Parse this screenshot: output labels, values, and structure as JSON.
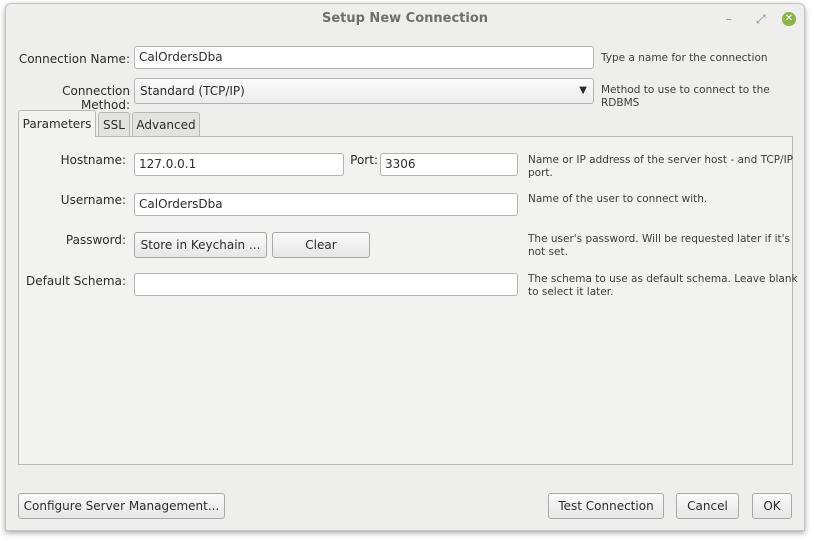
{
  "window": {
    "title": "Setup New Connection",
    "controls": {
      "minimize": "–",
      "maximize": "⤢",
      "close": "✕"
    }
  },
  "connection_name": {
    "label": "Connection Name:",
    "value": "CalOrdersDba",
    "hint": "Type a name for the connection"
  },
  "connection_method": {
    "label": "Connection Method:",
    "value": "Standard (TCP/IP)",
    "hint": "Method to use to connect to the RDBMS"
  },
  "tabs": [
    {
      "label": "Parameters",
      "active": true
    },
    {
      "label": "SSL",
      "active": false
    },
    {
      "label": "Advanced",
      "active": false
    }
  ],
  "parameters": {
    "hostname": {
      "label": "Hostname:",
      "value": "127.0.0.1",
      "port_label": "Port:",
      "port_value": "3306",
      "hint_line1": "Name or IP address of the server host - and TCP/IP",
      "hint_line2": "port."
    },
    "username": {
      "label": "Username:",
      "value": "CalOrdersDba",
      "hint": "Name of the user to connect with."
    },
    "password": {
      "label": "Password:",
      "store_button": "Store in Keychain ...",
      "clear_button": "Clear",
      "hint_line1": "The user's password. Will be requested later if it's",
      "hint_line2": "not set."
    },
    "default_schema": {
      "label": "Default Schema:",
      "value": "",
      "hint_line1": "The schema to use as default schema. Leave blank",
      "hint_line2": "to select it later."
    }
  },
  "footer": {
    "configure_button": "Configure Server Management...",
    "test_button": "Test Connection",
    "cancel_button": "Cancel",
    "ok_button": "OK"
  },
  "colors": {
    "window_bg": "#eeeeec",
    "close_button": "#8ab34a",
    "title_text": "#6f6f6f"
  }
}
